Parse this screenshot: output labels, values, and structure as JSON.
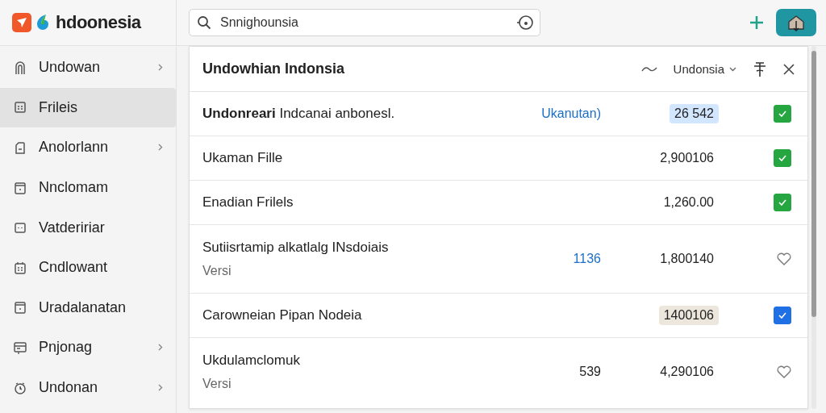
{
  "brand": {
    "name": "hdoonesia"
  },
  "search": {
    "value": "Snnighounsia"
  },
  "sidebar": {
    "items": [
      {
        "label": "Undowan",
        "chevron": true,
        "selected": false
      },
      {
        "label": "Frileis",
        "chevron": false,
        "selected": true
      },
      {
        "label": "Anolorlann",
        "chevron": true,
        "selected": false
      },
      {
        "label": "Nnclomam",
        "chevron": false,
        "selected": false
      },
      {
        "label": "Vatdeririar",
        "chevron": false,
        "selected": false
      },
      {
        "label": "Cndlowant",
        "chevron": false,
        "selected": false
      },
      {
        "label": "Uradalanatan",
        "chevron": false,
        "selected": false
      },
      {
        "label": "Pnjonag",
        "chevron": true,
        "selected": false
      },
      {
        "label": "Undonan",
        "chevron": true,
        "selected": false
      }
    ]
  },
  "panel": {
    "title": "Undowhian Indonsia",
    "filter": "Undonsia",
    "rows": [
      {
        "title": "**Undonreari** Indcanai anbonesl.",
        "extra": {
          "text": "Ukanutan)",
          "kind": "link"
        },
        "value": {
          "text": "26 542",
          "color": "#d3e6ff"
        },
        "kind": "check",
        "checked": true,
        "color": "#26a640"
      },
      {
        "title": "Ukaman Fille",
        "value": {
          "text": "2,900106"
        },
        "kind": "check",
        "checked": true,
        "color": "#26a640"
      },
      {
        "title": "Enadian Frilels",
        "value": {
          "text": "1,260.00"
        },
        "kind": "check",
        "checked": true,
        "color": "#26a640"
      },
      {
        "title": "Sutiisrtamip alkatlalg INsdoiais",
        "subtitle": "Versi",
        "extra": {
          "text": "1136",
          "kind": "link"
        },
        "value": {
          "text": "1,800140"
        },
        "kind": "favorite"
      },
      {
        "title": "Carowneian Pipan Nodeia",
        "value": {
          "text": "1400106",
          "color": "#ece6dc"
        },
        "kind": "check",
        "checked": true,
        "color": "#1f6fe5"
      },
      {
        "title": "Ukdulamclomuk",
        "subtitle": "Versi",
        "extra": {
          "text": "539",
          "kind": "plain"
        },
        "value": {
          "text": "4,290106"
        },
        "kind": "favorite"
      }
    ]
  }
}
